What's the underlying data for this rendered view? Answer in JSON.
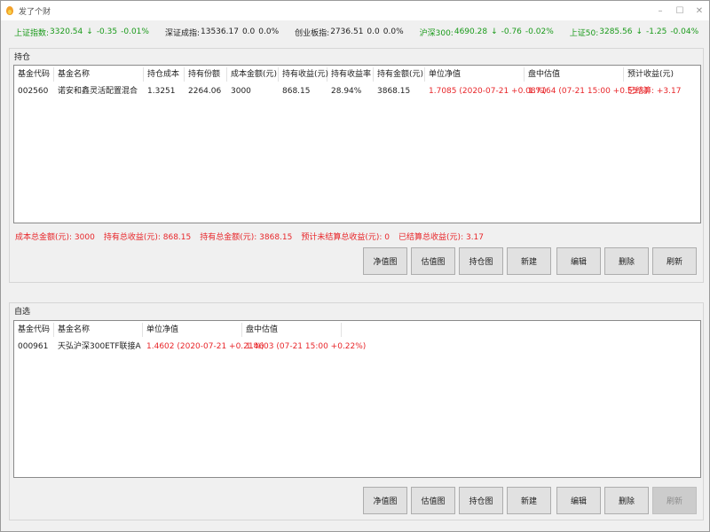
{
  "window": {
    "title": "发了个财",
    "controls": {
      "minimize": "–",
      "maximize": "☐",
      "close": "✕"
    }
  },
  "indices": [
    {
      "label": "上证指数:",
      "value": "3320.54",
      "arrow": "↓",
      "change": "-0.35",
      "pct": "-0.01%",
      "color": "#1a9a1a"
    },
    {
      "label": "深证成指:",
      "value": "13536.17",
      "arrow": "",
      "change": "0.0",
      "pct": "0.0%",
      "color": "#222222"
    },
    {
      "label": "创业板指:",
      "value": "2736.51",
      "arrow": "",
      "change": "0.0",
      "pct": "0.0%",
      "color": "#222222"
    },
    {
      "label": "沪深300:",
      "value": "4690.28",
      "arrow": "↓",
      "change": "-0.76",
      "pct": "-0.02%",
      "color": "#1a9a1a"
    },
    {
      "label": "上证50:",
      "value": "3285.56",
      "arrow": "↓",
      "change": "-1.25",
      "pct": "-0.04%",
      "color": "#1a9a1a"
    }
  ],
  "holdings": {
    "label": "持仓",
    "columns": [
      "基金代码",
      "基金名称",
      "持仓成本",
      "持有份额",
      "成本金额(元)",
      "持有收益(元)",
      "持有收益率",
      "持有金额(元)",
      "单位净值",
      "盘中估值",
      "预计收益(元)"
    ],
    "rows": [
      {
        "code": "002560",
        "name": "诺安和鑫灵活配置混合",
        "cost": "1.3251",
        "shares": "2264.06",
        "cost_amount": "3000",
        "profit": "868.15",
        "profit_rate": "28.94%",
        "amount": "3868.15",
        "nav": "1.7085 (2020-07-21  +0.08%)",
        "estimate": "1.7164 (07-21 15:00  +0.55%)",
        "expected": "已结算: +3.17"
      }
    ],
    "summary": [
      "成本总金额(元):  3000",
      "持有总收益(元):  868.15",
      "持有总金额(元):  3868.15",
      "预计未结算总收益(元):  0",
      "已结算总收益(元):  3.17"
    ],
    "buttons": [
      "净值图",
      "估值图",
      "持仓图",
      "新建",
      "编辑",
      "删除",
      "刷新"
    ]
  },
  "watchlist": {
    "label": "自选",
    "columns": [
      "基金代码",
      "基金名称",
      "单位净值",
      "盘中估值"
    ],
    "rows": [
      {
        "code": "000961",
        "name": "天弘沪深300ETF联接A",
        "nav": "1.4602 (2020-07-21  +0.21%)",
        "estimate": "1.4603 (07-21 15:00  +0.22%)"
      }
    ],
    "buttons": [
      "净值图",
      "估值图",
      "持仓图",
      "新建",
      "编辑",
      "删除",
      "刷新"
    ],
    "disabled_button": "刷新"
  },
  "colors": {
    "up": "#e8262a",
    "down": "#1a9a1a"
  }
}
